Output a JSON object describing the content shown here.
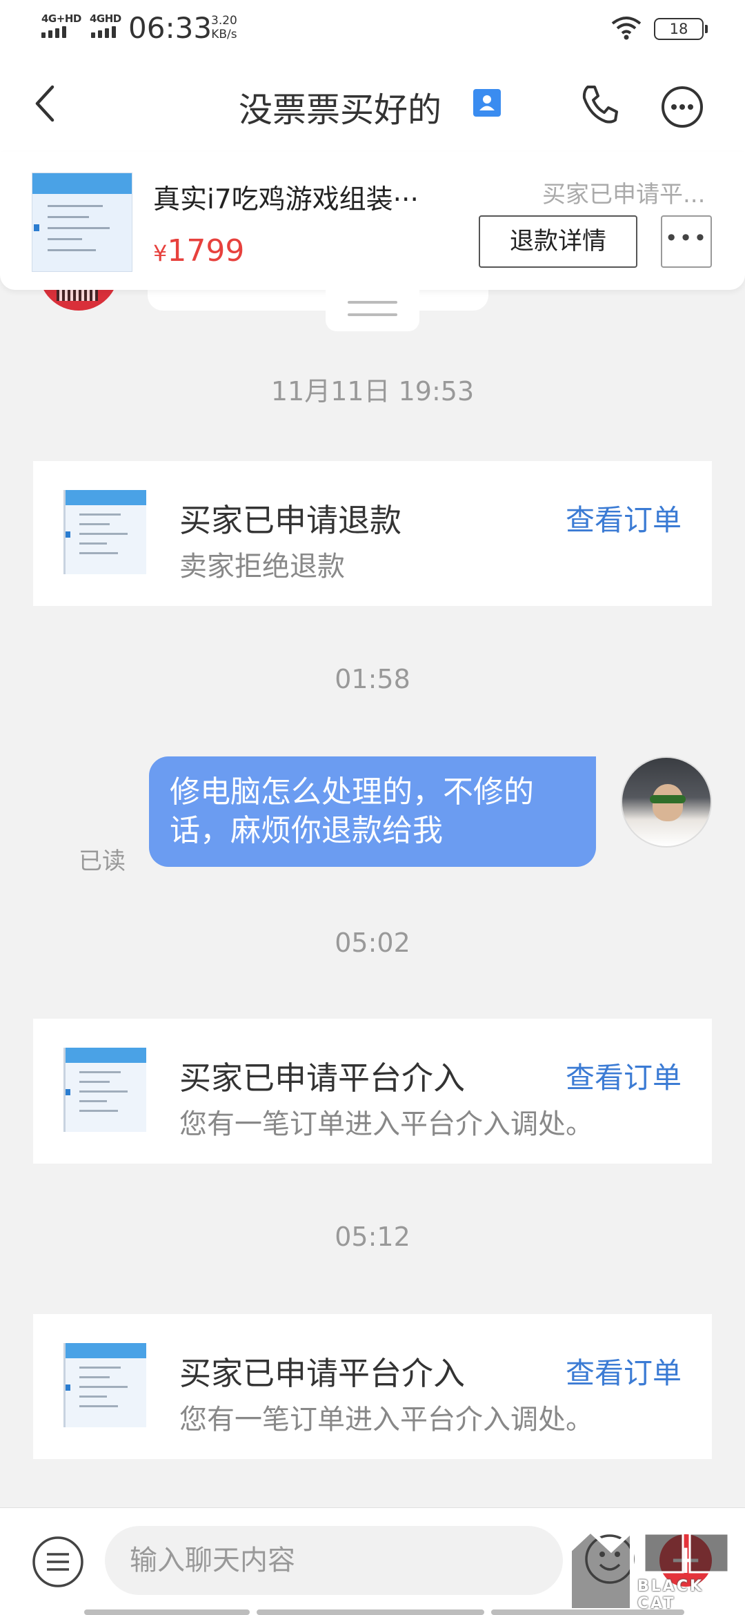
{
  "status_bar": {
    "network_1": "4G+HD",
    "network_2": "4GHD",
    "time": "06:33",
    "speed_value": "3.20",
    "speed_unit": "KB/s",
    "battery": "18"
  },
  "header": {
    "title": "没票票买好的",
    "icons": [
      "back-arrow-icon",
      "contact-card-icon",
      "phone-icon",
      "more-options-icon"
    ]
  },
  "product": {
    "name": "真实i7吃鸡游戏组装···",
    "status": "买家已申请平...",
    "currency": "¥",
    "price": "1799",
    "refund_button": "退款详情",
    "more_button": "•••"
  },
  "messages": {
    "ts1": "11月11日 19:53",
    "card1": {
      "title": "买家已申请退款",
      "subtitle": "卖家拒绝退款",
      "link": "查看订单"
    },
    "ts2": "01:58",
    "sent": {
      "line1": "修电脑怎么处理的，不修的",
      "line2": "话，麻烦你退款给我",
      "read": "已读"
    },
    "ts3": "05:02",
    "card2": {
      "title": "买家已申请平台介入",
      "subtitle": "您有一笔订单进入平台介入调处。",
      "link": "查看订单"
    },
    "ts4": "05:12",
    "card3": {
      "title": "买家已申请平台介入",
      "subtitle": "您有一笔订单进入平台介入调处。",
      "link": "查看订单"
    }
  },
  "input_bar": {
    "placeholder": "输入聊天内容",
    "plus_label": "+"
  },
  "watermark": {
    "text": "BLACK CAT"
  },
  "colors": {
    "accent_blue": "#3b7bd4",
    "bubble_blue": "#6b9cf1",
    "price_red": "#e7413d",
    "badge_red": "#e4333b"
  }
}
